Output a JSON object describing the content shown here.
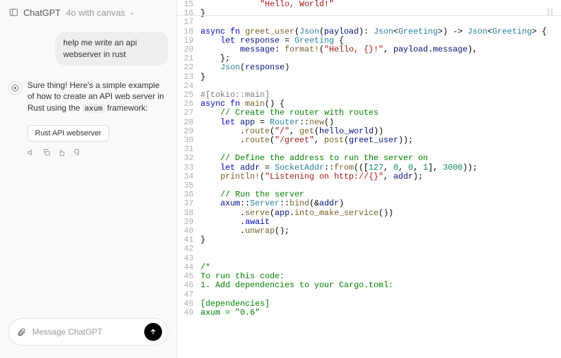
{
  "header": {
    "model": "ChatGPT",
    "suffix": "4o with canvas"
  },
  "user_message": "help me write an api webserver in rust",
  "assistant_message": {
    "pre": "Sure thing! Here's a simple example of how to create an API web server in Rust using the ",
    "code_word": "axum",
    "post": " framework:"
  },
  "canvas_button": "Rust API webserver",
  "input_placeholder": "Message ChatGPT",
  "code_lines": [
    {
      "n": 15,
      "tokens": [
        [
          "            ",
          "p"
        ],
        [
          "\"Hello, World!\"",
          "str"
        ]
      ]
    },
    {
      "n": 16,
      "tokens": [
        [
          "}",
          "p"
        ]
      ]
    },
    {
      "n": 17,
      "tokens": [
        [
          "",
          "p"
        ]
      ]
    },
    {
      "n": 18,
      "tokens": [
        [
          "async fn",
          "kw"
        ],
        [
          " ",
          "p"
        ],
        [
          "greet_user",
          "fn"
        ],
        [
          "(",
          "p"
        ],
        [
          "Json",
          "type"
        ],
        [
          "(",
          "p"
        ],
        [
          "payload",
          "id"
        ],
        [
          "): ",
          "p"
        ],
        [
          "Json",
          "type"
        ],
        [
          "<",
          "p"
        ],
        [
          "Greeting",
          "type"
        ],
        [
          ">) -> ",
          "p"
        ],
        [
          "Json",
          "type"
        ],
        [
          "<",
          "p"
        ],
        [
          "Greeting",
          "type"
        ],
        [
          "> {",
          "p"
        ]
      ]
    },
    {
      "n": 19,
      "tokens": [
        [
          "    ",
          "p"
        ],
        [
          "let",
          "kw"
        ],
        [
          " ",
          "p"
        ],
        [
          "response",
          "id"
        ],
        [
          " = ",
          "p"
        ],
        [
          "Greeting",
          "type"
        ],
        [
          " {",
          "p"
        ]
      ]
    },
    {
      "n": 20,
      "tokens": [
        [
          "        ",
          "p"
        ],
        [
          "message",
          "id"
        ],
        [
          ": ",
          "p"
        ],
        [
          "format!",
          "fn"
        ],
        [
          "(",
          "p"
        ],
        [
          "\"Hello, {}!\"",
          "str"
        ],
        [
          ", ",
          "p"
        ],
        [
          "payload",
          "id"
        ],
        [
          ".",
          "p"
        ],
        [
          "message",
          "id"
        ],
        [
          "),",
          "p"
        ]
      ]
    },
    {
      "n": 21,
      "tokens": [
        [
          "    };",
          "p"
        ]
      ]
    },
    {
      "n": 22,
      "tokens": [
        [
          "    ",
          "p"
        ],
        [
          "Json",
          "type"
        ],
        [
          "(",
          "p"
        ],
        [
          "response",
          "id"
        ],
        [
          ")",
          "p"
        ]
      ]
    },
    {
      "n": 23,
      "tokens": [
        [
          "}",
          "p"
        ]
      ]
    },
    {
      "n": 24,
      "tokens": [
        [
          "",
          "p"
        ]
      ]
    },
    {
      "n": 25,
      "tokens": [
        [
          "#[tokio::main]",
          "attr"
        ]
      ]
    },
    {
      "n": 26,
      "tokens": [
        [
          "async fn",
          "kw"
        ],
        [
          " ",
          "p"
        ],
        [
          "main",
          "fn"
        ],
        [
          "() {",
          "p"
        ]
      ]
    },
    {
      "n": 27,
      "tokens": [
        [
          "    ",
          "p"
        ],
        [
          "// Create the router with routes",
          "cmt"
        ]
      ]
    },
    {
      "n": 28,
      "tokens": [
        [
          "    ",
          "p"
        ],
        [
          "let",
          "kw"
        ],
        [
          " ",
          "p"
        ],
        [
          "app",
          "id"
        ],
        [
          " = ",
          "p"
        ],
        [
          "Router",
          "type"
        ],
        [
          "::",
          "p"
        ],
        [
          "new",
          "fn"
        ],
        [
          "()",
          "p"
        ]
      ]
    },
    {
      "n": 29,
      "tokens": [
        [
          "        .",
          "p"
        ],
        [
          "route",
          "fn"
        ],
        [
          "(",
          "p"
        ],
        [
          "\"/\"",
          "str"
        ],
        [
          ", ",
          "p"
        ],
        [
          "get",
          "fn"
        ],
        [
          "(",
          "p"
        ],
        [
          "hello_world",
          "id"
        ],
        [
          "))",
          "p"
        ]
      ]
    },
    {
      "n": 30,
      "tokens": [
        [
          "        .",
          "p"
        ],
        [
          "route",
          "fn"
        ],
        [
          "(",
          "p"
        ],
        [
          "\"/greet\"",
          "str"
        ],
        [
          ", ",
          "p"
        ],
        [
          "post",
          "fn"
        ],
        [
          "(",
          "p"
        ],
        [
          "greet_user",
          "id"
        ],
        [
          "));",
          "p"
        ]
      ]
    },
    {
      "n": 31,
      "tokens": [
        [
          "",
          "p"
        ]
      ]
    },
    {
      "n": 32,
      "tokens": [
        [
          "    ",
          "p"
        ],
        [
          "// Define the address to run the server on",
          "cmt"
        ]
      ]
    },
    {
      "n": 33,
      "tokens": [
        [
          "    ",
          "p"
        ],
        [
          "let",
          "kw"
        ],
        [
          " ",
          "p"
        ],
        [
          "addr",
          "id"
        ],
        [
          " = ",
          "p"
        ],
        [
          "SocketAddr",
          "type"
        ],
        [
          "::",
          "p"
        ],
        [
          "from",
          "fn"
        ],
        [
          "(([",
          "p"
        ],
        [
          "127",
          "num"
        ],
        [
          ", ",
          "p"
        ],
        [
          "0",
          "num"
        ],
        [
          ", ",
          "p"
        ],
        [
          "0",
          "num"
        ],
        [
          ", ",
          "p"
        ],
        [
          "1",
          "num"
        ],
        [
          "], ",
          "p"
        ],
        [
          "3000",
          "num"
        ],
        [
          "));",
          "p"
        ]
      ]
    },
    {
      "n": 34,
      "tokens": [
        [
          "    ",
          "p"
        ],
        [
          "println!",
          "fn"
        ],
        [
          "(",
          "p"
        ],
        [
          "\"Listening on http://{}\"",
          "str"
        ],
        [
          ", ",
          "p"
        ],
        [
          "addr",
          "id"
        ],
        [
          ");",
          "p"
        ]
      ]
    },
    {
      "n": 35,
      "tokens": [
        [
          "",
          "p"
        ]
      ]
    },
    {
      "n": 36,
      "tokens": [
        [
          "    ",
          "p"
        ],
        [
          "// Run the server",
          "cmt"
        ]
      ]
    },
    {
      "n": 37,
      "tokens": [
        [
          "    ",
          "p"
        ],
        [
          "axum",
          "id"
        ],
        [
          "::",
          "p"
        ],
        [
          "Server",
          "type"
        ],
        [
          "::",
          "p"
        ],
        [
          "bind",
          "fn"
        ],
        [
          "(&",
          "p"
        ],
        [
          "addr",
          "id"
        ],
        [
          ")",
          "p"
        ]
      ]
    },
    {
      "n": 38,
      "tokens": [
        [
          "        .",
          "p"
        ],
        [
          "serve",
          "fn"
        ],
        [
          "(",
          "p"
        ],
        [
          "app",
          "id"
        ],
        [
          ".",
          "p"
        ],
        [
          "into_make_service",
          "fn"
        ],
        [
          "())",
          "p"
        ]
      ]
    },
    {
      "n": 39,
      "tokens": [
        [
          "        .",
          "p"
        ],
        [
          "await",
          "kw"
        ]
      ]
    },
    {
      "n": 40,
      "tokens": [
        [
          "        .",
          "p"
        ],
        [
          "unwrap",
          "fn"
        ],
        [
          "();",
          "p"
        ]
      ]
    },
    {
      "n": 41,
      "tokens": [
        [
          "}",
          "p"
        ]
      ]
    },
    {
      "n": 42,
      "tokens": [
        [
          "",
          "p"
        ]
      ]
    },
    {
      "n": 43,
      "tokens": [
        [
          "",
          "p"
        ]
      ]
    },
    {
      "n": 44,
      "tokens": [
        [
          "/*",
          "cmt"
        ]
      ]
    },
    {
      "n": 45,
      "tokens": [
        [
          "To run this code:",
          "cmt"
        ]
      ]
    },
    {
      "n": 46,
      "tokens": [
        [
          "1. Add dependencies to your Cargo.toml:",
          "cmt"
        ]
      ]
    },
    {
      "n": 47,
      "tokens": [
        [
          "",
          "p"
        ]
      ]
    },
    {
      "n": 48,
      "tokens": [
        [
          "[dependencies]",
          "cmt"
        ]
      ]
    },
    {
      "n": 49,
      "tokens": [
        [
          "axum = \"0.6\"",
          "cmt"
        ]
      ]
    }
  ]
}
